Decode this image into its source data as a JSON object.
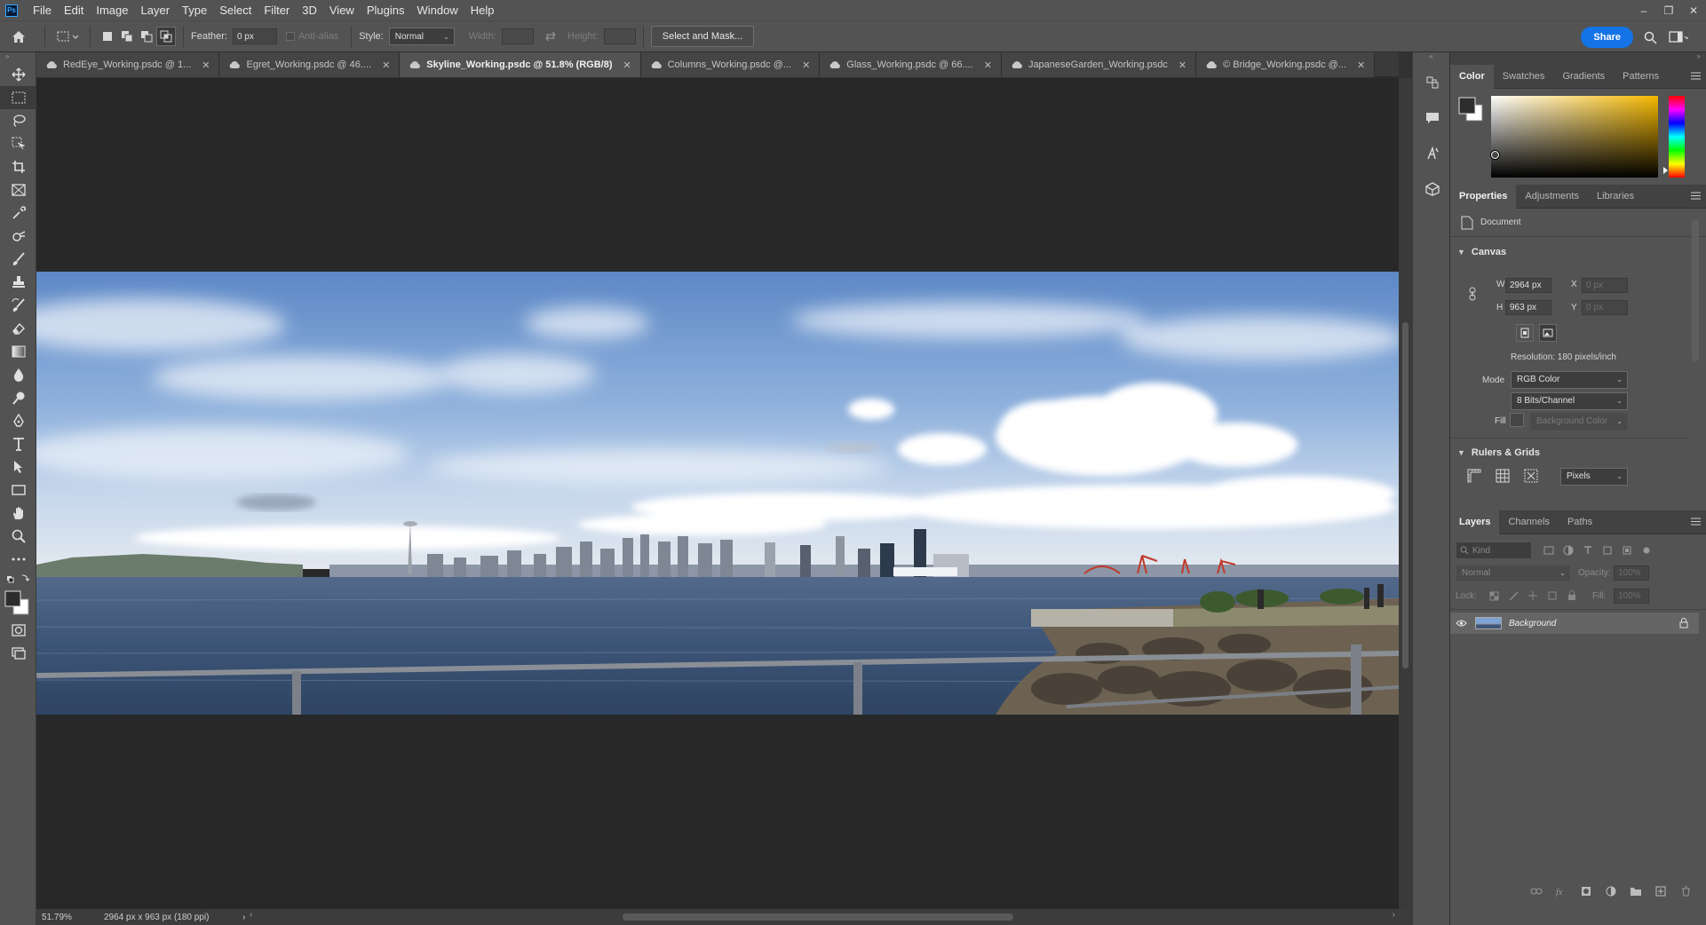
{
  "app": {
    "logo": "Ps"
  },
  "menu": [
    "File",
    "Edit",
    "Image",
    "Layer",
    "Type",
    "Select",
    "Filter",
    "3D",
    "View",
    "Plugins",
    "Window",
    "Help"
  ],
  "window_controls": {
    "minimize": "–",
    "restore": "❐",
    "close": "✕"
  },
  "options": {
    "feather_label": "Feather:",
    "feather_value": "0 px",
    "antialias_label": "Anti-alias",
    "style_label": "Style:",
    "style_value": "Normal",
    "width_label": "Width:",
    "height_label": "Height:",
    "select_mask_label": "Select and Mask...",
    "share_label": "Share"
  },
  "tabs": [
    {
      "label": "RedEye_Working.psdc @ 1...",
      "active": false
    },
    {
      "label": "Egret_Working.psdc @ 46....",
      "active": false
    },
    {
      "label": "Skyline_Working.psdc @ 51.8% (RGB/8)",
      "active": true
    },
    {
      "label": "Columns_Working.psdc @...",
      "active": false
    },
    {
      "label": "Glass_Working.psdc @ 66....",
      "active": false
    },
    {
      "label": "JapaneseGarden_Working.psdc",
      "active": false
    },
    {
      "label": "© Bridge_Working.psdc @...",
      "active": false
    }
  ],
  "tab_close": "✕",
  "status": {
    "zoom": "51.79%",
    "doc_info": "2964 px x 963 px (180 ppi)",
    "arrow": "›",
    "scroll_left": "‹",
    "scroll_right": "›"
  },
  "color_panel": {
    "tabs": [
      "Color",
      "Swatches",
      "Gradients",
      "Patterns"
    ],
    "active": "Color",
    "hue_color": "#f5b800"
  },
  "properties_panel": {
    "tabs": [
      "Properties",
      "Adjustments",
      "Libraries"
    ],
    "active": "Properties",
    "doc_label": "Document",
    "canvas_title": "Canvas",
    "w_label": "W",
    "w_value": "2964 px",
    "h_label": "H",
    "h_value": "963 px",
    "x_label": "X",
    "x_value": "0 px",
    "y_label": "Y",
    "y_value": "0 px",
    "resolution": "Resolution: 180 pixels/inch",
    "mode_label": "Mode",
    "mode_value": "RGB Color",
    "bits_value": "8 Bits/Channel",
    "fill_label": "Fill",
    "fill_value": "Background Color",
    "rulers_title": "Rulers & Grids",
    "units_value": "Pixels"
  },
  "layers_panel": {
    "tabs": [
      "Layers",
      "Channels",
      "Paths"
    ],
    "active": "Layers",
    "kind_placeholder": "Kind",
    "blend_value": "Normal",
    "opacity_label": "Opacity:",
    "opacity_value": "100%",
    "lock_label": "Lock:",
    "fill_label": "Fill:",
    "fill_value": "100%",
    "layers": [
      {
        "name": "Background",
        "visible": true,
        "locked": true
      }
    ]
  }
}
